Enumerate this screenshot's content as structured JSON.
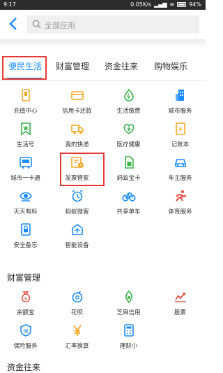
{
  "status": {
    "time": "9:17",
    "speed": "0.05K/s",
    "battery": "94%"
  },
  "header": {
    "search_placeholder": "全部应用"
  },
  "tabs": [
    {
      "label": "便民生活"
    },
    {
      "label": "财富管理"
    },
    {
      "label": "资金往来"
    },
    {
      "label": "购物娱乐"
    }
  ],
  "sections": [
    {
      "title": "",
      "items": [
        {
          "label": "充值中心",
          "icon": "phone-icon"
        },
        {
          "label": "信用卡还款",
          "icon": "card-icon"
        },
        {
          "label": "生活缴费",
          "icon": "drop-icon"
        },
        {
          "label": "城市服务",
          "icon": "building-icon"
        },
        {
          "label": "生活号",
          "icon": "star-doc-icon"
        },
        {
          "label": "我的快递",
          "icon": "truck-icon"
        },
        {
          "label": "医疗健康",
          "icon": "health-icon"
        },
        {
          "label": "记账本",
          "icon": "ledger-icon"
        },
        {
          "label": "城市一卡通",
          "icon": "bus-card-icon"
        },
        {
          "label": "发票管家",
          "icon": "invoice-icon"
        },
        {
          "label": "蚂蚁宝卡",
          "icon": "sim-icon"
        },
        {
          "label": "车主服务",
          "icon": "car-icon"
        },
        {
          "label": "天天有料",
          "icon": "eye-icon"
        },
        {
          "label": "蚂蚁微客",
          "icon": "alarm-icon"
        },
        {
          "label": "共享单车",
          "icon": "bike-icon"
        },
        {
          "label": "体育服务",
          "icon": "runner-icon"
        },
        {
          "label": "安全备忘",
          "icon": "lock-icon"
        },
        {
          "label": "智能设备",
          "icon": "device-icon"
        }
      ]
    },
    {
      "title": "财富管理",
      "items": [
        {
          "label": "余额宝",
          "icon": "moneybag-icon"
        },
        {
          "label": "花呗",
          "icon": "huabei-icon"
        },
        {
          "label": "芝麻信用",
          "icon": "sesame-icon"
        },
        {
          "label": "股票",
          "icon": "stock-icon"
        },
        {
          "label": "保险服务",
          "icon": "shield-icon"
        },
        {
          "label": "汇率换算",
          "icon": "yen-icon"
        },
        {
          "label": "理财小",
          "icon": "calc-icon"
        }
      ]
    },
    {
      "title": "资金往来",
      "items": []
    }
  ],
  "colors": {
    "accent": "#1a8cff",
    "orange": "#f5a623",
    "green": "#39b54a",
    "red": "#e84c3d",
    "highlight": "#e53935"
  }
}
